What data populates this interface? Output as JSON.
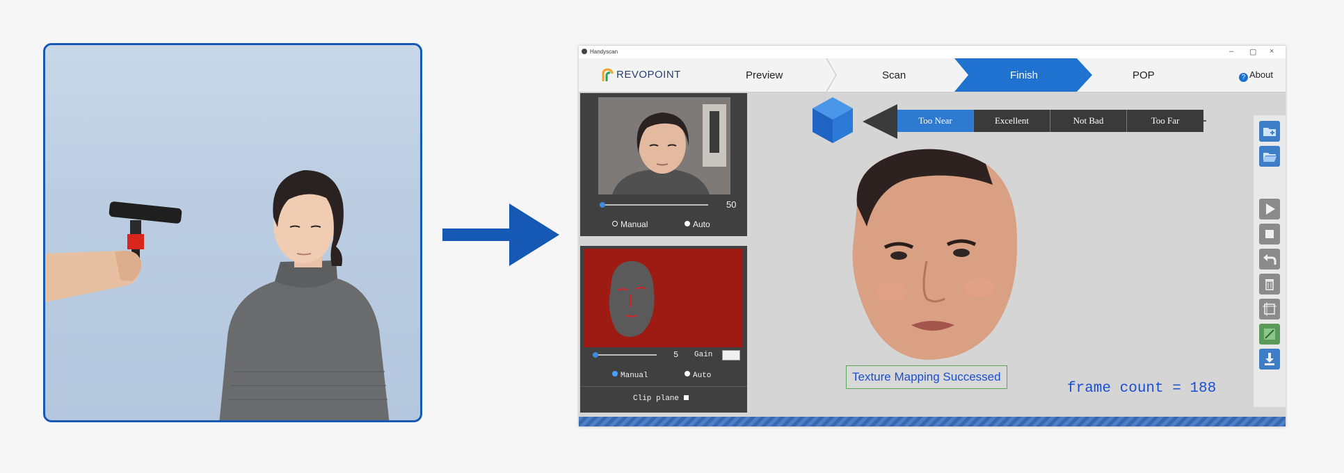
{
  "window": {
    "title": "Handyscan",
    "controls": [
      "–",
      "▢",
      "×"
    ]
  },
  "nav": {
    "logo": "REVOPOINT",
    "steps": [
      "Preview",
      "Scan",
      "Finish",
      "POP"
    ],
    "active_step": "Finish",
    "about": "About"
  },
  "rgb_panel": {
    "slider_value": "50",
    "slider_fraction": 0.1,
    "mode_manual": "Manual",
    "mode_auto": "Auto",
    "selected_mode": "Auto"
  },
  "depth_panel": {
    "slider_value": "5",
    "slider_fraction": 0.05,
    "gain_label": "Gain",
    "mode_manual": "Manual",
    "mode_auto": "Auto",
    "selected_mode": "Manual",
    "clip_plane": "Clip plane"
  },
  "distance_bar": {
    "options": [
      "Too Near",
      "Excellent",
      "Not Bad",
      "Too Far"
    ],
    "selected": "Too Near"
  },
  "status": {
    "texture": "Texture Mapping Successed",
    "frame_count": "frame count = 188"
  },
  "toolbar": {
    "buttons": [
      "new-folder-icon",
      "open-folder-icon",
      "play-icon",
      "stop-icon",
      "undo-icon",
      "trash-icon",
      "crop-icon",
      "edit-image-icon",
      "download-icon"
    ]
  },
  "colors": {
    "accent": "#1a6fcf",
    "frame_border": "#1559b4",
    "depth_bg": "#9e1b13"
  }
}
